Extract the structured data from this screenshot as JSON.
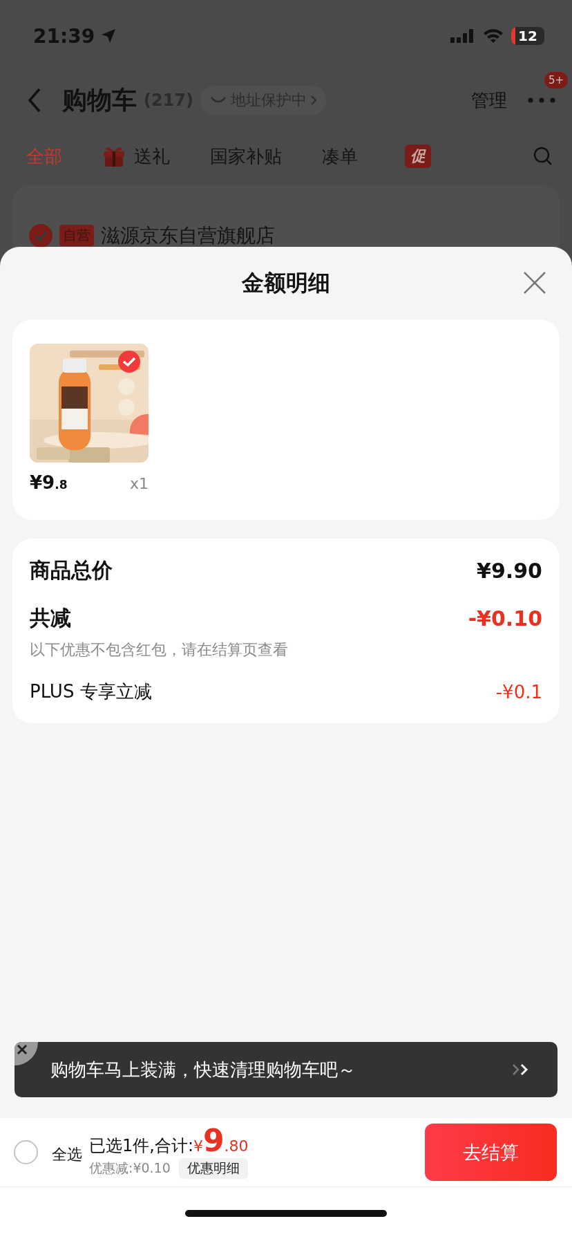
{
  "status_bar": {
    "time": "21:39",
    "battery": "12"
  },
  "nav": {
    "title": "购物车",
    "count": "(217)",
    "address_badge": "地址保护中",
    "manage": "管理",
    "more_badge": "5+"
  },
  "tabs": [
    {
      "label": "全部",
      "selected": true,
      "kind": "text"
    },
    {
      "label": "送礼",
      "selected": false,
      "kind": "gift"
    },
    {
      "label": "国家补贴",
      "selected": false,
      "kind": "text"
    },
    {
      "label": "凑单",
      "selected": false,
      "kind": "text"
    },
    {
      "label": "促",
      "selected": false,
      "kind": "badge"
    }
  ],
  "store": {
    "checked": true,
    "tag": "自营",
    "name": "滋源京东自营旗舰店"
  },
  "sheet": {
    "title": "金额明细",
    "items": [
      {
        "price_int": "¥9",
        "price_dec": ".8",
        "qty": "x1",
        "selected": true
      }
    ],
    "summary": [
      {
        "kind": "total",
        "label": "商品总价",
        "value": "¥9.90"
      },
      {
        "kind": "discount",
        "label": "共减",
        "value": "-¥0.10",
        "note": "以下优惠不包含红包，请在结算页查看"
      },
      {
        "kind": "sub",
        "label": "PLUS 专享立减",
        "value": "-¥0.1"
      }
    ]
  },
  "banner": {
    "text": "购物车马上装满，快速清理购物车吧～"
  },
  "footer": {
    "select_all": {
      "label": "全选",
      "checked": false
    },
    "selected_text": "已选1件,合计:",
    "currency": "¥",
    "total_int": "9",
    "total_dec": ".80",
    "discount": "优惠减:¥0.10",
    "detail_button": "优惠明细",
    "checkout": "去结算"
  }
}
